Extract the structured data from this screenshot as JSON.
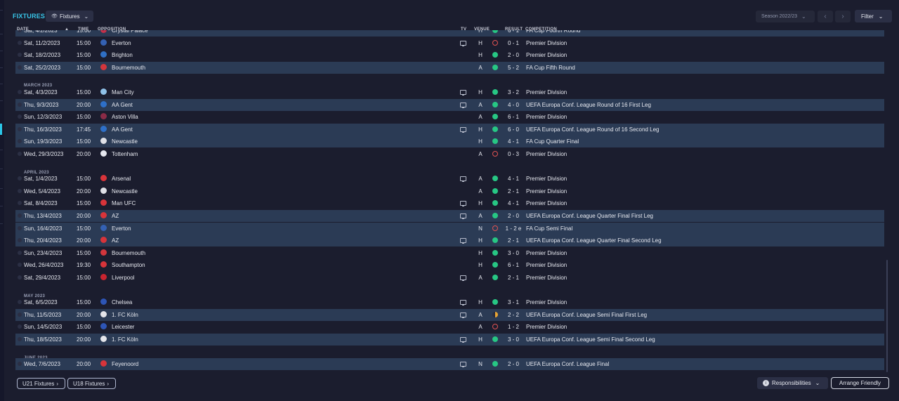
{
  "header": {
    "title": "FIXTURES",
    "view_dropdown": {
      "label": "Fixtures",
      "icon": "eye-icon"
    },
    "season": "Season 2022/23",
    "filter_label": "Filter"
  },
  "columns": {
    "date": "DATE",
    "time": "TIME",
    "opposition": "OPPOSITION",
    "tv": "TV",
    "venue": "VENUE",
    "result": "RESULT",
    "competition": "COMPETITION"
  },
  "colors": {
    "accent": "#38c7ea",
    "win": "#27c784",
    "loss": "#e05252",
    "draw": "#e8a534",
    "highlight_row": "#2b3b55"
  },
  "fixtures": [
    {
      "date": "Sat, 4/2/2023",
      "time": "15:00",
      "opponent": "Crystal Palace",
      "crest": "#c6304a",
      "tv": false,
      "venue": "H",
      "outcome": "W",
      "score": "6 - 1",
      "competition": "FA Cup Fourth Round",
      "highlight": true
    },
    {
      "date": "Sat, 11/2/2023",
      "time": "15:00",
      "opponent": "Everton",
      "crest": "#3461b3",
      "tv": true,
      "venue": "H",
      "outcome": "L",
      "score": "0 - 1",
      "competition": "Premier Division",
      "highlight": false
    },
    {
      "date": "Sat, 18/2/2023",
      "time": "15:00",
      "opponent": "Brighton",
      "crest": "#2f6fc4",
      "tv": false,
      "venue": "H",
      "outcome": "W",
      "score": "2 - 0",
      "competition": "Premier Division",
      "highlight": false
    },
    {
      "date": "Sat, 25/2/2023",
      "time": "15:00",
      "opponent": "Bournemouth",
      "crest": "#d2363c",
      "tv": false,
      "venue": "A",
      "outcome": "W",
      "score": "5 - 2",
      "competition": "FA Cup Fifth Round",
      "highlight": true
    },
    {
      "month": "MARCH 2023"
    },
    {
      "date": "Sat, 4/3/2023",
      "time": "15:00",
      "opponent": "Man City",
      "crest": "#8fc1e8",
      "tv": true,
      "venue": "H",
      "outcome": "W",
      "score": "3 - 2",
      "competition": "Premier Division",
      "highlight": false
    },
    {
      "date": "Thu, 9/3/2023",
      "time": "20:00",
      "opponent": "AA Gent",
      "crest": "#2e70c9",
      "tv": true,
      "venue": "A",
      "outcome": "W",
      "score": "4 - 0",
      "competition": "UEFA Europa Conf. League Round of 16  First Leg",
      "highlight": true
    },
    {
      "date": "Sun, 12/3/2023",
      "time": "15:00",
      "opponent": "Aston Villa",
      "crest": "#8a2b47",
      "tv": false,
      "venue": "A",
      "outcome": "W",
      "score": "6 - 1",
      "competition": "Premier Division",
      "highlight": false
    },
    {
      "date": "Thu, 16/3/2023",
      "time": "17:45",
      "opponent": "AA Gent",
      "crest": "#2e70c9",
      "tv": true,
      "venue": "H",
      "outcome": "W",
      "score": "6 - 0",
      "competition": "UEFA Europa Conf. League Round of 16  Second Leg",
      "highlight": true
    },
    {
      "date": "Sun, 19/3/2023",
      "time": "15:00",
      "opponent": "Newcastle",
      "crest": "#dfe0e6",
      "tv": false,
      "venue": "H",
      "outcome": "W",
      "score": "4 - 1",
      "competition": "FA Cup Quarter Final",
      "highlight": true
    },
    {
      "date": "Wed, 29/3/2023",
      "time": "20:00",
      "opponent": "Tottenham",
      "crest": "#e6e8ef",
      "tv": false,
      "venue": "A",
      "outcome": "L",
      "score": "0 - 3",
      "competition": "Premier Division",
      "highlight": false
    },
    {
      "month": "APRIL 2023"
    },
    {
      "date": "Sat, 1/4/2023",
      "time": "15:00",
      "opponent": "Arsenal",
      "crest": "#d8343a",
      "tv": true,
      "venue": "A",
      "outcome": "W",
      "score": "4 - 1",
      "competition": "Premier Division",
      "highlight": false
    },
    {
      "date": "Wed, 5/4/2023",
      "time": "20:00",
      "opponent": "Newcastle",
      "crest": "#dfe0e6",
      "tv": false,
      "venue": "A",
      "outcome": "W",
      "score": "2 - 1",
      "competition": "Premier Division",
      "highlight": false
    },
    {
      "date": "Sat, 8/4/2023",
      "time": "15:00",
      "opponent": "Man UFC",
      "crest": "#d8343a",
      "tv": true,
      "venue": "H",
      "outcome": "W",
      "score": "4 - 1",
      "competition": "Premier Division",
      "highlight": false
    },
    {
      "date": "Thu, 13/4/2023",
      "time": "20:00",
      "opponent": "AZ",
      "crest": "#d8343a",
      "tv": true,
      "venue": "A",
      "outcome": "W",
      "score": "2 - 0",
      "competition": "UEFA Europa Conf. League Quarter Final First Leg",
      "highlight": true
    },
    {
      "date": "Sun, 16/4/2023",
      "time": "15:00",
      "opponent": "Everton",
      "crest": "#3461b3",
      "tv": false,
      "venue": "N",
      "outcome": "L",
      "score": "1 - 2 e",
      "competition": "FA Cup Semi Final",
      "highlight": true
    },
    {
      "date": "Thu, 20/4/2023",
      "time": "20:00",
      "opponent": "AZ",
      "crest": "#d8343a",
      "tv": true,
      "venue": "H",
      "outcome": "W",
      "score": "2 - 1",
      "competition": "UEFA Europa Conf. League Quarter Final Second Leg",
      "highlight": true
    },
    {
      "date": "Sun, 23/4/2023",
      "time": "15:00",
      "opponent": "Bournemouth",
      "crest": "#d2363c",
      "tv": false,
      "venue": "H",
      "outcome": "W",
      "score": "3 - 0",
      "competition": "Premier Division",
      "highlight": false
    },
    {
      "date": "Wed, 26/4/2023",
      "time": "19:30",
      "opponent": "Southampton",
      "crest": "#d8343a",
      "tv": false,
      "venue": "H",
      "outcome": "W",
      "score": "6 - 1",
      "competition": "Premier Division",
      "highlight": false
    },
    {
      "date": "Sat, 29/4/2023",
      "time": "15:00",
      "opponent": "Liverpool",
      "crest": "#c8242f",
      "tv": true,
      "venue": "A",
      "outcome": "W",
      "score": "2 - 1",
      "competition": "Premier Division",
      "highlight": false
    },
    {
      "month": "MAY 2023"
    },
    {
      "date": "Sat, 6/5/2023",
      "time": "15:00",
      "opponent": "Chelsea",
      "crest": "#2d55b6",
      "tv": true,
      "venue": "H",
      "outcome": "W",
      "score": "3 - 1",
      "competition": "Premier Division",
      "highlight": false
    },
    {
      "date": "Thu, 11/5/2023",
      "time": "20:00",
      "opponent": "1. FC Köln",
      "crest": "#e4e5ea",
      "tv": true,
      "venue": "A",
      "outcome": "D",
      "score": "2 - 2",
      "competition": "UEFA Europa Conf. League Semi Final First Leg",
      "highlight": true
    },
    {
      "date": "Sun, 14/5/2023",
      "time": "15:00",
      "opponent": "Leicester",
      "crest": "#2d55b6",
      "tv": false,
      "venue": "A",
      "outcome": "L",
      "score": "1 - 2",
      "competition": "Premier Division",
      "highlight": false
    },
    {
      "date": "Thu, 18/5/2023",
      "time": "20:00",
      "opponent": "1. FC Köln",
      "crest": "#e4e5ea",
      "tv": true,
      "venue": "H",
      "outcome": "W",
      "score": "3 - 0",
      "competition": "UEFA Europa Conf. League Semi Final Second Leg",
      "highlight": true
    },
    {
      "month": "JUNE 2023"
    },
    {
      "date": "Wed, 7/6/2023",
      "time": "20:00",
      "opponent": "Feyenoord",
      "crest": "#d8343a",
      "tv": true,
      "venue": "N",
      "outcome": "W",
      "score": "2 - 0",
      "competition": "UEFA Europa Conf. League Final",
      "highlight": true
    }
  ],
  "footer": {
    "u21_label": "U21 Fixtures",
    "u18_label": "U18 Fixtures",
    "responsibilities_label": "Responsibilities",
    "arrange_label": "Arrange Friendly"
  }
}
